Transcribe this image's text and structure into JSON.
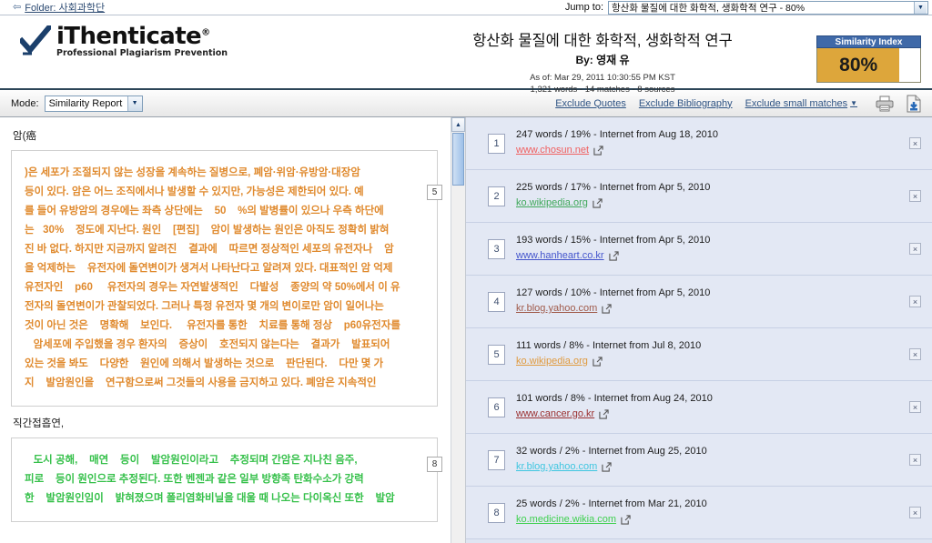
{
  "topbar": {
    "folder_arrow": "⇦",
    "folder_label": "Folder: 사회과학단",
    "jump_label": "Jump to:",
    "jump_value": "항산화 물질에 대한 화학적, 생화학적 연구 - 80%"
  },
  "brand": {
    "name": "iThenticate",
    "registered": "®",
    "tagline": "Professional Plagiarism Prevention"
  },
  "document": {
    "title": "항산화 물질에 대한 화학적, 생화학적 연구",
    "author": "By: 영재 유",
    "as_of": "As of: Mar 29, 2011 10:30:55 PM KST",
    "stats": "1,321 words - 14 matches - 8 sources"
  },
  "similarity": {
    "title": "Similarity Index",
    "value": "80%",
    "fill_percent": 80,
    "fill_color": "#dda63b",
    "header_color": "#3f69a8"
  },
  "toolbar": {
    "mode_label": "Mode:",
    "mode_value": "Similarity Report",
    "exclude_quotes": "Exclude Quotes",
    "exclude_bibliography": "Exclude Bibliography",
    "exclude_small_matches": "Exclude small matches",
    "caret": "▼",
    "print_icon": "printer-icon",
    "download_icon": "download-icon"
  },
  "content": {
    "section_1_label": "암(癌",
    "section_2_label": "직간접흡연,",
    "para1_tag": "5",
    "para2_tag": "8",
    "para1_lines": [
      ")은 세포가 조절되지 않는 성장을 계속하는 질병으로, 폐암·위암·유방암·대장암",
      "등이 있다. 암은 어느 조직에서나 발생할 수 있지만, 가능성은 제한되어 있다. 예",
      "를 들어 유방암의 경우에는 좌측 상단에는    50    %의 발병률이 있으나 우측 하단에",
      "는   30%    정도에 지난다. 원인    [편집]    암이 발생하는 원인은 아직도 정확히 밝혀",
      "진 바 없다. 하지만 지금까지 알려진    결과에    따르면 정상적인 세포의 유전자나    암",
      "을 억제하는    유전자에 돌연변이가 생겨서 나타난다고 알려져 있다. 대표적인 암 억제",
      "유전자인    p60     유전자의 경우는 자연발생적인    다발성    종양의 약 50%에서 이 유",
      "전자의 돌연변이가 관찰되었다. 그러나 특정 유전자 몇 개의 변이로만 암이 일어나는",
      "것이 아닌 것은    명확해    보인다.     유전자를 통한    치료를 통해 정상    p60유전자를",
      "   암세포에 주입했을 경우 환자의    증상이    호전되지 않는다는    결과가    발표되어",
      "있는 것을 봐도    다양한    원인에 의해서 발생하는 것으로    판단된다.    다만 몇 가",
      "지    발암원인을    연구함으로써 그것들의 사용을 금지하고 있다. 폐암은 지속적인"
    ],
    "para2_lines": [
      "   도시 공해,    매연    등이    발암원인이라고    추정되며 간암은 지나친 음주,",
      "피로    등이 원인으로 추정된다. 또한 벤젠과 같은 일부 방향족 탄화수소가 강력",
      "한    발암원인임이    밝혀졌으며 폴리염화비닐을 대울 때 나오는 다이옥신 또한    발암"
    ]
  },
  "sources": {
    "close_glyph": "×",
    "items": [
      {
        "num": "1",
        "meta": "247 words / 19% - Internet from Aug 18, 2010",
        "url": "www.chosun.net",
        "color": "#f06060"
      },
      {
        "num": "2",
        "meta": "225 words / 17% - Internet from Apr 5, 2010",
        "url": "ko.wikipedia.org",
        "color": "#3fa85a"
      },
      {
        "num": "3",
        "meta": "193 words / 15% - Internet from Apr 5, 2010",
        "url": "www.hanheart.co.kr",
        "color": "#4455cc"
      },
      {
        "num": "4",
        "meta": "127 words / 10% - Internet from Apr 5, 2010",
        "url": "kr.blog.yahoo.com",
        "color": "#a05a4a"
      },
      {
        "num": "5",
        "meta": "111 words / 8% - Internet from Jul 8, 2010",
        "url": "ko.wikipedia.org",
        "color": "#e09a3e"
      },
      {
        "num": "6",
        "meta": "101 words / 8% - Internet from Aug 24, 2010",
        "url": "www.cancer.go.kr",
        "color": "#9a2f2f"
      },
      {
        "num": "7",
        "meta": "32 words / 2% - Internet from Aug 25, 2010",
        "url": "kr.blog.yahoo.com",
        "color": "#3fc6e0"
      },
      {
        "num": "8",
        "meta": "25 words / 2% - Internet from Mar 21, 2010",
        "url": "ko.medicine.wikia.com",
        "color": "#3fd04f"
      }
    ]
  }
}
